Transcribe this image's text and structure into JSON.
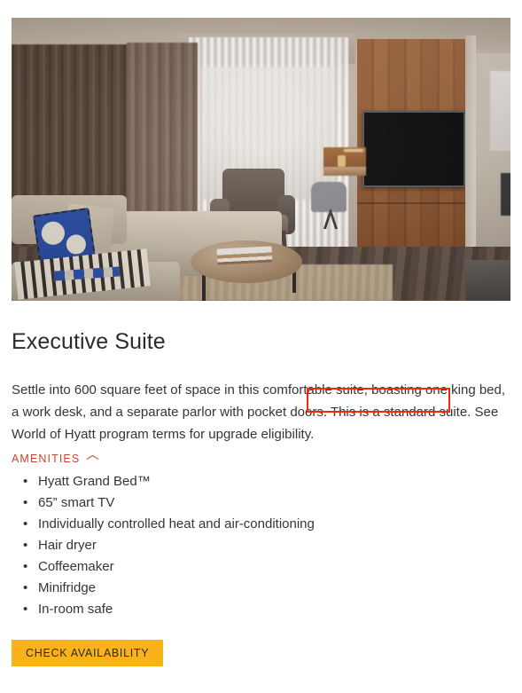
{
  "room": {
    "photo_alt": "Executive Suite living area with sofa, armchair, coffee table, work desk and wall-mounted flat screen TV",
    "title": "Executive Suite",
    "description_part1": "Settle into 600 square feet of space in this comfortable suite, boasting one king bed, a work desk, and a separate parlor with pocket doors. ",
    "description_highlight": "This is a standard suite.",
    "description_part2": " See World of Hyatt program terms for upgrade eligibility."
  },
  "amenities": {
    "section_label": "AMENITIES",
    "toggle_icon": "chevron-up-icon",
    "items": [
      "Hyatt Grand Bed™",
      "65” smart TV",
      "Individually controlled heat and air-conditioning",
      "Hair dryer",
      "Coffeemaker",
      "Minifridge",
      "In-room safe"
    ]
  },
  "cta": {
    "label": "CHECK AVAILABILITY"
  },
  "colors": {
    "accent_red": "#c8452c",
    "cta_background": "#f9b218",
    "highlight_outline": "#ef2b0c",
    "body_text": "#353535"
  }
}
